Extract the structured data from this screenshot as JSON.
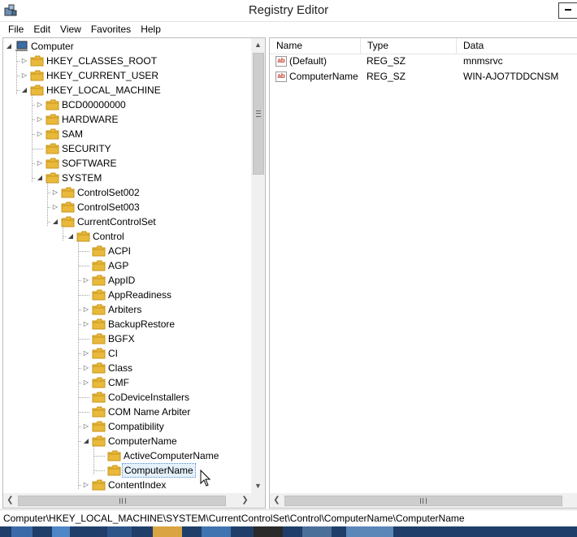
{
  "window": {
    "title": "Registry Editor"
  },
  "menu": [
    "File",
    "Edit",
    "View",
    "Favorites",
    "Help"
  ],
  "tree": [
    {
      "label": "Computer",
      "level": 0,
      "expander": "open",
      "icon": "computer"
    },
    {
      "label": "HKEY_CLASSES_ROOT",
      "level": 1,
      "expander": "closed"
    },
    {
      "label": "HKEY_CURRENT_USER",
      "level": 1,
      "expander": "closed"
    },
    {
      "label": "HKEY_LOCAL_MACHINE",
      "level": 1,
      "expander": "open"
    },
    {
      "label": "BCD00000000",
      "level": 2,
      "expander": "closed"
    },
    {
      "label": "HARDWARE",
      "level": 2,
      "expander": "closed"
    },
    {
      "label": "SAM",
      "level": 2,
      "expander": "closed"
    },
    {
      "label": "SECURITY",
      "level": 2,
      "expander": "none"
    },
    {
      "label": "SOFTWARE",
      "level": 2,
      "expander": "closed"
    },
    {
      "label": "SYSTEM",
      "level": 2,
      "expander": "open"
    },
    {
      "label": "ControlSet002",
      "level": 3,
      "expander": "closed"
    },
    {
      "label": "ControlSet003",
      "level": 3,
      "expander": "closed"
    },
    {
      "label": "CurrentControlSet",
      "level": 3,
      "expander": "open"
    },
    {
      "label": "Control",
      "level": 4,
      "expander": "open"
    },
    {
      "label": "ACPI",
      "level": 5,
      "expander": "none"
    },
    {
      "label": "AGP",
      "level": 5,
      "expander": "none"
    },
    {
      "label": "AppID",
      "level": 5,
      "expander": "closed"
    },
    {
      "label": "AppReadiness",
      "level": 5,
      "expander": "none"
    },
    {
      "label": "Arbiters",
      "level": 5,
      "expander": "closed"
    },
    {
      "label": "BackupRestore",
      "level": 5,
      "expander": "closed"
    },
    {
      "label": "BGFX",
      "level": 5,
      "expander": "none"
    },
    {
      "label": "CI",
      "level": 5,
      "expander": "closed"
    },
    {
      "label": "Class",
      "level": 5,
      "expander": "closed"
    },
    {
      "label": "CMF",
      "level": 5,
      "expander": "closed"
    },
    {
      "label": "CoDeviceInstallers",
      "level": 5,
      "expander": "none"
    },
    {
      "label": "COM Name Arbiter",
      "level": 5,
      "expander": "none"
    },
    {
      "label": "Compatibility",
      "level": 5,
      "expander": "closed"
    },
    {
      "label": "ComputerName",
      "level": 5,
      "expander": "open"
    },
    {
      "label": "ActiveComputerName",
      "level": 6,
      "expander": "none"
    },
    {
      "label": "ComputerName",
      "level": 6,
      "expander": "none",
      "selected": true
    },
    {
      "label": "ContentIndex",
      "level": 5,
      "expander": "closed"
    }
  ],
  "list": {
    "columns": [
      "Name",
      "Type",
      "Data"
    ],
    "rows": [
      {
        "name": "(Default)",
        "type": "REG_SZ",
        "data": "mnmsrvc"
      },
      {
        "name": "ComputerName",
        "type": "REG_SZ",
        "data": "WIN-AJO7TDDCNSM"
      }
    ]
  },
  "status": {
    "path": "Computer\\HKEY_LOCAL_MACHINE\\SYSTEM\\CurrentControlSet\\Control\\ComputerName\\ComputerName"
  },
  "colors": {
    "folder": "#e8b93a",
    "folder_dark": "#c9951c",
    "selection": "#e5f1fb",
    "taskbar": "#1f3f6a"
  },
  "icons": {
    "app": "registry-editor-icon",
    "value": "string-value-icon",
    "folder": "folder-icon"
  }
}
